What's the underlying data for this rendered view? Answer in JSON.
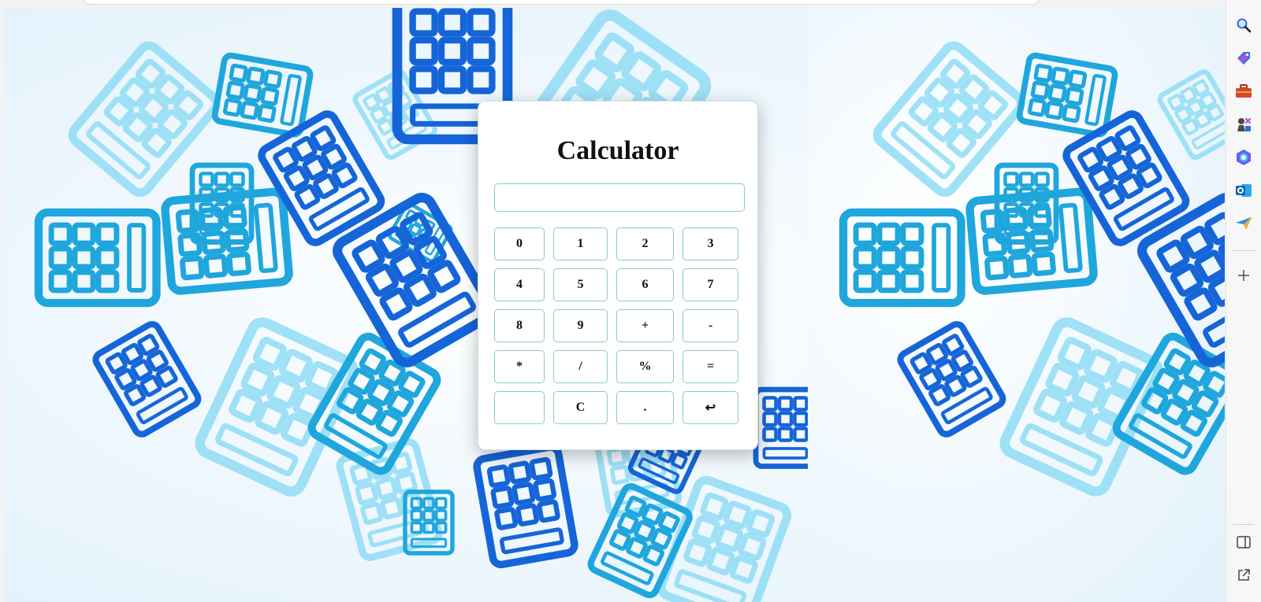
{
  "calculator": {
    "title": "Calculator",
    "display_value": "",
    "keys": [
      "0",
      "1",
      "2",
      "3",
      "4",
      "5",
      "6",
      "7",
      "8",
      "9",
      "+",
      "-",
      "*",
      "/",
      "%",
      "=",
      "",
      "C",
      ".",
      "↩"
    ]
  },
  "sidebar": {
    "icons": [
      "search-icon",
      "tag-icon",
      "toolbox-icon",
      "chess-icon",
      "copilot-icon",
      "outlook-icon",
      "send-icon",
      "add-icon",
      "split-screen-icon",
      "open-external-icon"
    ]
  },
  "colors": {
    "accent_border": "#8ec9c4",
    "tile_dark": "#1565d8",
    "tile_mid": "#1fa6dc",
    "tile_light": "#8fdcf5"
  }
}
